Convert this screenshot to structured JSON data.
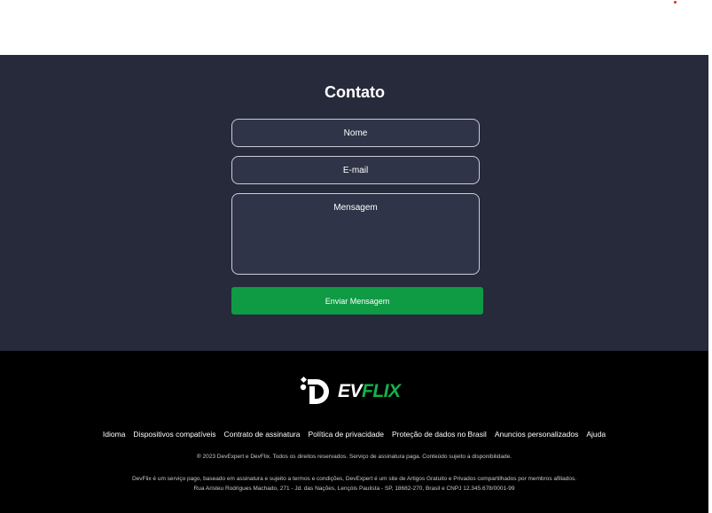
{
  "colors": {
    "contact_bg": "#262a3a",
    "field_border": "#c9ccd8",
    "button_bg": "#0f9a44",
    "footer_bg": "#000000",
    "brand_green": "#12b24a"
  },
  "contact": {
    "title": "Contato",
    "name_placeholder": "Nome",
    "email_placeholder": "E-mail",
    "message_placeholder": "Mensagem",
    "submit_label": "Enviar Mensagem"
  },
  "footer": {
    "logo": {
      "ev": "EV",
      "flix": "FLIX",
      "icon": "devflix-d-logo-icon"
    },
    "links": [
      "Idioma",
      "Dispositivos compatíveis",
      "Contrato de assinatura",
      "Política de privacidade",
      "Proteção de dados no Brasil",
      "Anuncios personalizados",
      "Ajuda"
    ],
    "copyright": "® 2023 DevExpert e DevFlix. Todos os direitos reservados. Serviço de assinatura paga. Conteúdo sujeito a disponibilidade.",
    "legal_line1": "DevFlix é um serviço pago, baseado em assinatura e sujeito a termos e condições, DevExpert é um site de Artigos Gratuito e Privados compartilhados por membros afiliados.",
    "legal_line2": "Rua Aristeu Rodrigues Machado, 271 - Jd. das Nações, Lençóis Paulista - SP, 18682-270, Brasil e CNPJ 12.345.678/0001-99"
  }
}
